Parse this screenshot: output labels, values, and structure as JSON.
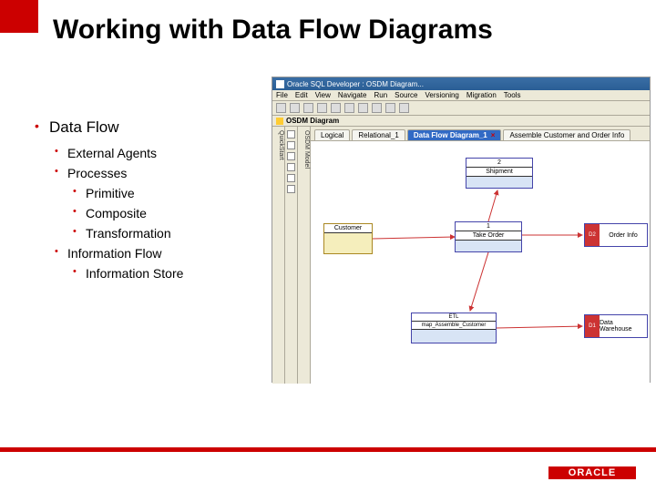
{
  "slide": {
    "title": "Working with Data Flow Diagrams",
    "bullets": {
      "dataflow": "Data Flow",
      "external_agents": "External Agents",
      "processes": "Processes",
      "primitive": "Primitive",
      "composite": "Composite",
      "transformation": "Transformation",
      "information_flow": "Information Flow",
      "information_store": "Information Store"
    }
  },
  "app": {
    "window_title": "Oracle SQL Developer : OSDM Diagram...",
    "menus": [
      "File",
      "Edit",
      "View",
      "Navigate",
      "Run",
      "Source",
      "Versioning",
      "Migration",
      "Tools"
    ],
    "sub_tab_label": "OSDM Diagram",
    "side_tab_left": "QuickStart",
    "side_tab_right": "OSDM Model",
    "tabs": [
      {
        "label": "Logical",
        "active": false
      },
      {
        "label": "Relational_1",
        "active": false
      },
      {
        "label": "Data Flow Diagram_1",
        "active": true
      },
      {
        "label": "Assemble Customer and Order Info",
        "active": false
      }
    ],
    "diagram": {
      "shipment": {
        "num": "2",
        "label": "Shipment"
      },
      "customer": {
        "num": "",
        "label": "Customer"
      },
      "take_order": {
        "num": "1",
        "label": "Take Order"
      },
      "etl": {
        "num": "ETL",
        "label": "map_Assemble_Customer"
      },
      "order_info": {
        "tag": "D2",
        "label": "Order Info"
      },
      "warehouse": {
        "tag": "D1",
        "label": "Data Warehouse"
      }
    }
  },
  "footer": {
    "brand": "ORACLE"
  }
}
